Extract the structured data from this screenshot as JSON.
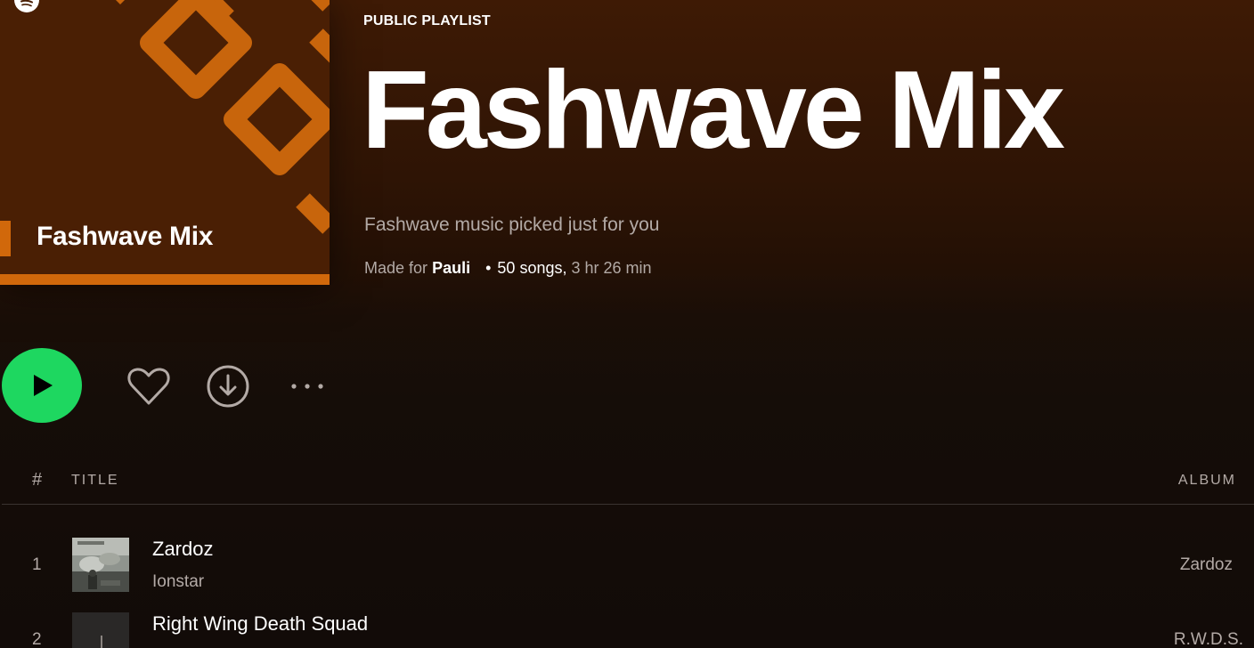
{
  "header": {
    "cover_title": "Fashwave Mix",
    "type_label": "PUBLIC PLAYLIST",
    "title": "Fashwave Mix",
    "description": "Fashwave music picked just for you",
    "meta_prefix": "Made for",
    "owner": "Pauli",
    "separator": "•",
    "song_count": "50 songs,",
    "duration": "3 hr 26 min"
  },
  "actions": {
    "play_icon": "play-icon",
    "like_icon": "heart-icon",
    "download_icon": "download-icon",
    "more_icon": "more-icon"
  },
  "table": {
    "col_num": "#",
    "col_title": "TITLE",
    "col_album": "ALBUM",
    "tracks": [
      {
        "num": "1",
        "title": "Zardoz",
        "artist": "Ionstar",
        "album": "Zardoz"
      },
      {
        "num": "2",
        "title": "Right Wing Death Squad",
        "artist": "",
        "album": "R.W.D.S."
      }
    ]
  },
  "colors": {
    "accent": "#1ed760",
    "cover_bg": "#4a1f04",
    "cover_pattern": "#c8650c",
    "header_bg": "#3e1a05",
    "muted_text": "#b3aaa6"
  }
}
